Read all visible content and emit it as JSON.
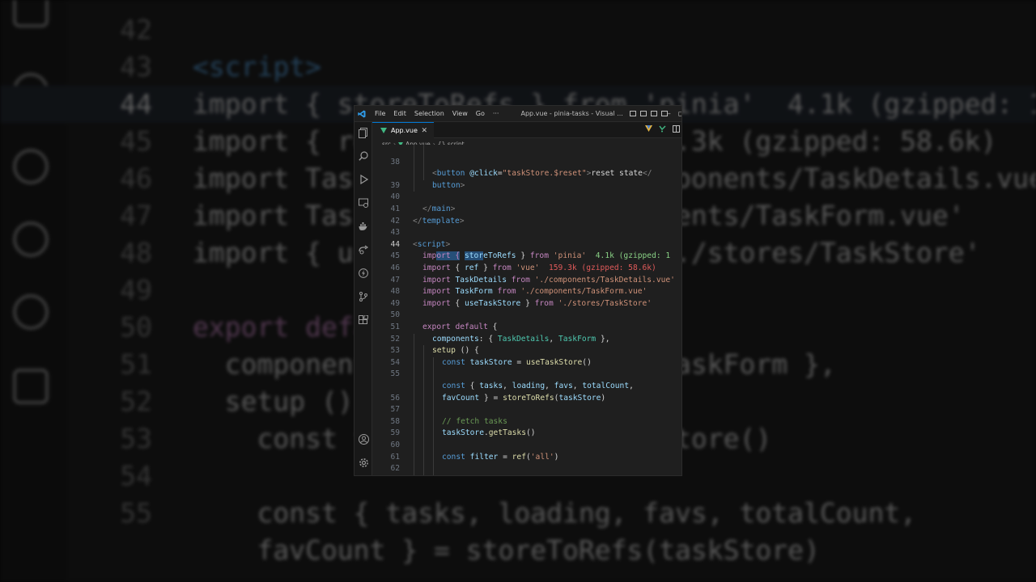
{
  "window": {
    "title": "App.vue - pinia-tasks - Visual ...",
    "menu": [
      "File",
      "Edit",
      "Selection",
      "View",
      "Go",
      "···"
    ]
  },
  "tab": {
    "label": "App.vue",
    "close": "✕"
  },
  "breadcrumb": {
    "items": [
      "src",
      "App.vue",
      "{} script"
    ]
  },
  "code_lines": [
    {
      "n": "38",
      "text": "<button @click=\"taskStore.$reset\">reset state</"
    },
    {
      "n": "",
      "text": "button>"
    },
    {
      "n": "39",
      "text": ""
    },
    {
      "n": "40",
      "text": "</main>"
    },
    {
      "n": "41",
      "text": "</template>"
    },
    {
      "n": "42",
      "text": ""
    },
    {
      "n": "43",
      "text": "<script>"
    },
    {
      "n": "44",
      "text": "import { storeToRefs } from 'pinia'"
    },
    {
      "n": "45",
      "text": "import { ref } from 'vue'"
    },
    {
      "n": "46",
      "text": "import TaskDetails from './components/TaskDetails.vue'"
    },
    {
      "n": "47",
      "text": "import TaskForm from './components/TaskForm.vue'"
    },
    {
      "n": "48",
      "text": "import { useTaskStore } from './stores/TaskStore'"
    },
    {
      "n": "49",
      "text": ""
    },
    {
      "n": "50",
      "text": "export default {"
    },
    {
      "n": "51",
      "text": "components: { TaskDetails, TaskForm },"
    },
    {
      "n": "52",
      "text": "setup () {"
    },
    {
      "n": "53",
      "text": "const taskStore = useTaskStore()"
    },
    {
      "n": "54",
      "text": ""
    },
    {
      "n": "55",
      "text": "const { tasks, loading, favs, totalCount,"
    },
    {
      "n": "",
      "text": "favCount } = storeToRefs(taskStore)"
    },
    {
      "n": "56",
      "text": ""
    },
    {
      "n": "57",
      "text": "// fetch tasks"
    },
    {
      "n": "58",
      "text": "taskStore.getTasks()"
    },
    {
      "n": "59",
      "text": ""
    },
    {
      "n": "60",
      "text": "const filter = ref('all')"
    },
    {
      "n": "61",
      "text": ""
    },
    {
      "n": "62",
      "text": "return { taskStore, filter, tasks, loading, favs,"
    },
    {
      "n": "",
      "text": "totalCount, favCount }"
    }
  ],
  "import_cost": {
    "pinia": "4.1k (gzipped: 1",
    "vue": "159.3k (gzipped: 58.6k)"
  },
  "background_zoom": {
    "lines": [
      {
        "n": "42",
        "text": ""
      },
      {
        "n": "43",
        "text": "<script>"
      },
      {
        "n": "44",
        "text": "import { storeToRefs } from 'pinia'  4.1k (gzipped: 1"
      },
      {
        "n": "45",
        "text": "import { ref } from 'vue'  159.3k (gzipped: 58.6k)"
      },
      {
        "n": "46",
        "text": "import TaskDetails from './components/TaskDetails.vue"
      },
      {
        "n": "47",
        "text": "import TaskForm from './components/TaskForm.vue'"
      },
      {
        "n": "48",
        "text": "import { useTaskStore } from './stores/TaskStore'"
      },
      {
        "n": "49",
        "text": ""
      },
      {
        "n": "50",
        "text": "export default {"
      },
      {
        "n": "51",
        "text": "  components: { TaskDetails, TaskForm },"
      },
      {
        "n": "52",
        "text": "  setup () {"
      },
      {
        "n": "53",
        "text": "    const taskStore = useTaskStore()"
      },
      {
        "n": "54",
        "text": ""
      },
      {
        "n": "55",
        "text": "    const { tasks, loading, favs, totalCount,"
      },
      {
        "n": "",
        "text": "    favCount } = storeToRefs(taskStore)"
      }
    ]
  },
  "colors": {
    "editor_bg": "#1f1f1f",
    "activity_bg": "#181818",
    "accent": "#0078d4",
    "vue_green": "#41b883"
  }
}
